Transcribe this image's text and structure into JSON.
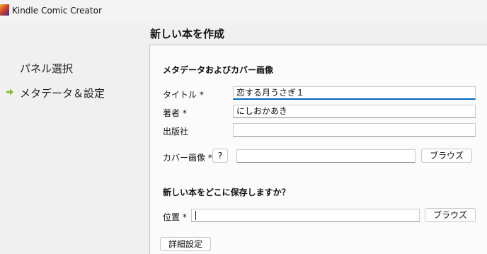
{
  "window": {
    "title": "Kindle Comic Creator",
    "icon": "kindle-comic-creator-app-icon"
  },
  "header": {
    "title": "新しい本を作成"
  },
  "sidebar": {
    "items": [
      {
        "label": "パネル選択",
        "active": false
      },
      {
        "label": "メタデータ＆設定",
        "active": true,
        "icon": "arrow-right-icon"
      }
    ]
  },
  "metadata": {
    "section_title": "メタデータおよびカバー画像",
    "title_label": "タイトル *",
    "title_value": "恋する月うさぎ１",
    "author_label": "著者 *",
    "author_value": "にしおかあき",
    "publisher_label": "出版社",
    "publisher_value": "",
    "cover_label": "カバー画像 *",
    "cover_help": "?",
    "cover_value": "",
    "browse_label": "ブラウズ"
  },
  "save": {
    "section_title": "新しい本をどこに保存しますか？",
    "location_label": "位置 *",
    "location_value": "",
    "browse_label": "ブラウズ"
  },
  "advanced": {
    "button_label": "詳細設定"
  },
  "colors": {
    "accent": "#0067c0",
    "nav_arrow": "#8ab83c",
    "background": "#f0f0f0",
    "panel": "#fbfbfb"
  }
}
